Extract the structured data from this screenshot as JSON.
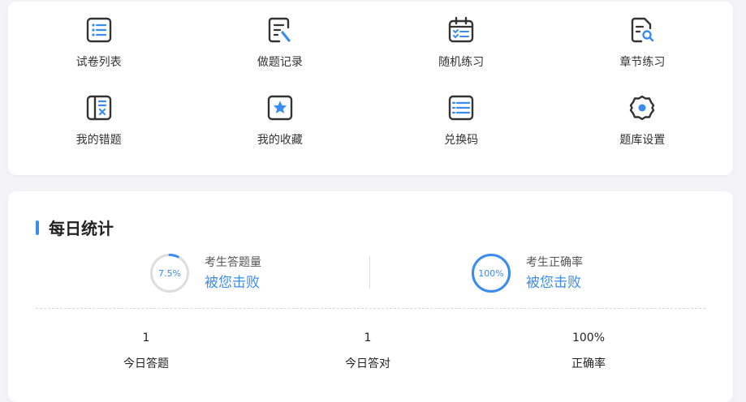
{
  "menu": {
    "items": [
      {
        "label": "试卷列表",
        "icon": "list-icon"
      },
      {
        "label": "做题记录",
        "icon": "edit-record-icon"
      },
      {
        "label": "随机练习",
        "icon": "calendar-check-icon"
      },
      {
        "label": "章节练习",
        "icon": "document-search-icon"
      },
      {
        "label": "我的错题",
        "icon": "wrong-book-icon"
      },
      {
        "label": "我的收藏",
        "icon": "star-icon"
      },
      {
        "label": "兑换码",
        "icon": "code-list-icon"
      },
      {
        "label": "题库设置",
        "icon": "gear-icon"
      }
    ]
  },
  "stats": {
    "title": "每日统计",
    "gauges": [
      {
        "value_text": "7.5%",
        "percent": 7.5,
        "caption": "考生答题量",
        "link": "被您击败"
      },
      {
        "value_text": "100%",
        "percent": 100,
        "caption": "考生正确率",
        "link": "被您击败"
      }
    ],
    "columns": [
      {
        "value": "1",
        "label": "今日答题"
      },
      {
        "value": "1",
        "label": "今日答对"
      },
      {
        "value": "100%",
        "label": "正确率"
      }
    ]
  },
  "colors": {
    "accent": "#3a8cf0",
    "icon_dark": "#333333",
    "track": "#dddddd"
  }
}
